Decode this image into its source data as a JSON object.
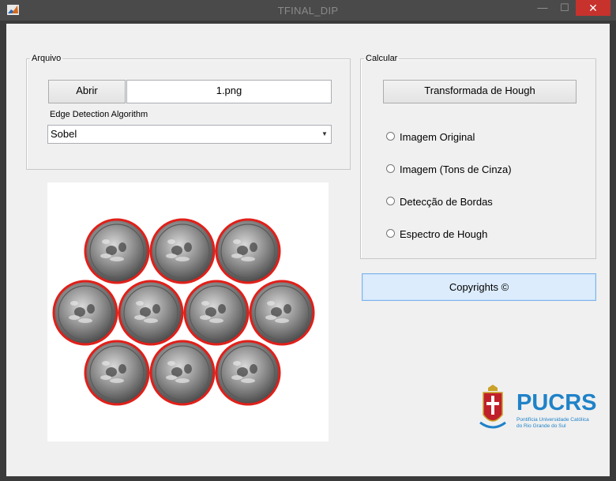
{
  "window": {
    "title": "TFINAL_DIP",
    "minimize_glyph": "—",
    "maximize_glyph": "☐",
    "close_glyph": "✕"
  },
  "arquivo": {
    "legend": "Arquivo",
    "open_label": "Abrir",
    "filename_value": "1.png",
    "algorithm_label": "Edge Detection Algorithm",
    "algorithm_selected": "Sobel"
  },
  "calcular": {
    "legend": "Calcular",
    "hough_label": "Transformada de Hough",
    "options": [
      {
        "label": "Imagem Original",
        "checked": false
      },
      {
        "label": "Imagem (Tons de Cinza)",
        "checked": false
      },
      {
        "label": "Detecção de Bordas",
        "checked": false
      },
      {
        "label": "Espectro de Hough",
        "checked": false
      }
    ]
  },
  "copyright_label": "Copyrights ©",
  "logo": {
    "brand": "PUCRS",
    "tagline_line1": "Pontifícia Universidade Católica",
    "tagline_line2": "do Rio Grande do Sul"
  },
  "colors": {
    "coin_ring": "#e0201a",
    "brand_blue": "#1f82c8",
    "close_red": "#c7322d"
  }
}
